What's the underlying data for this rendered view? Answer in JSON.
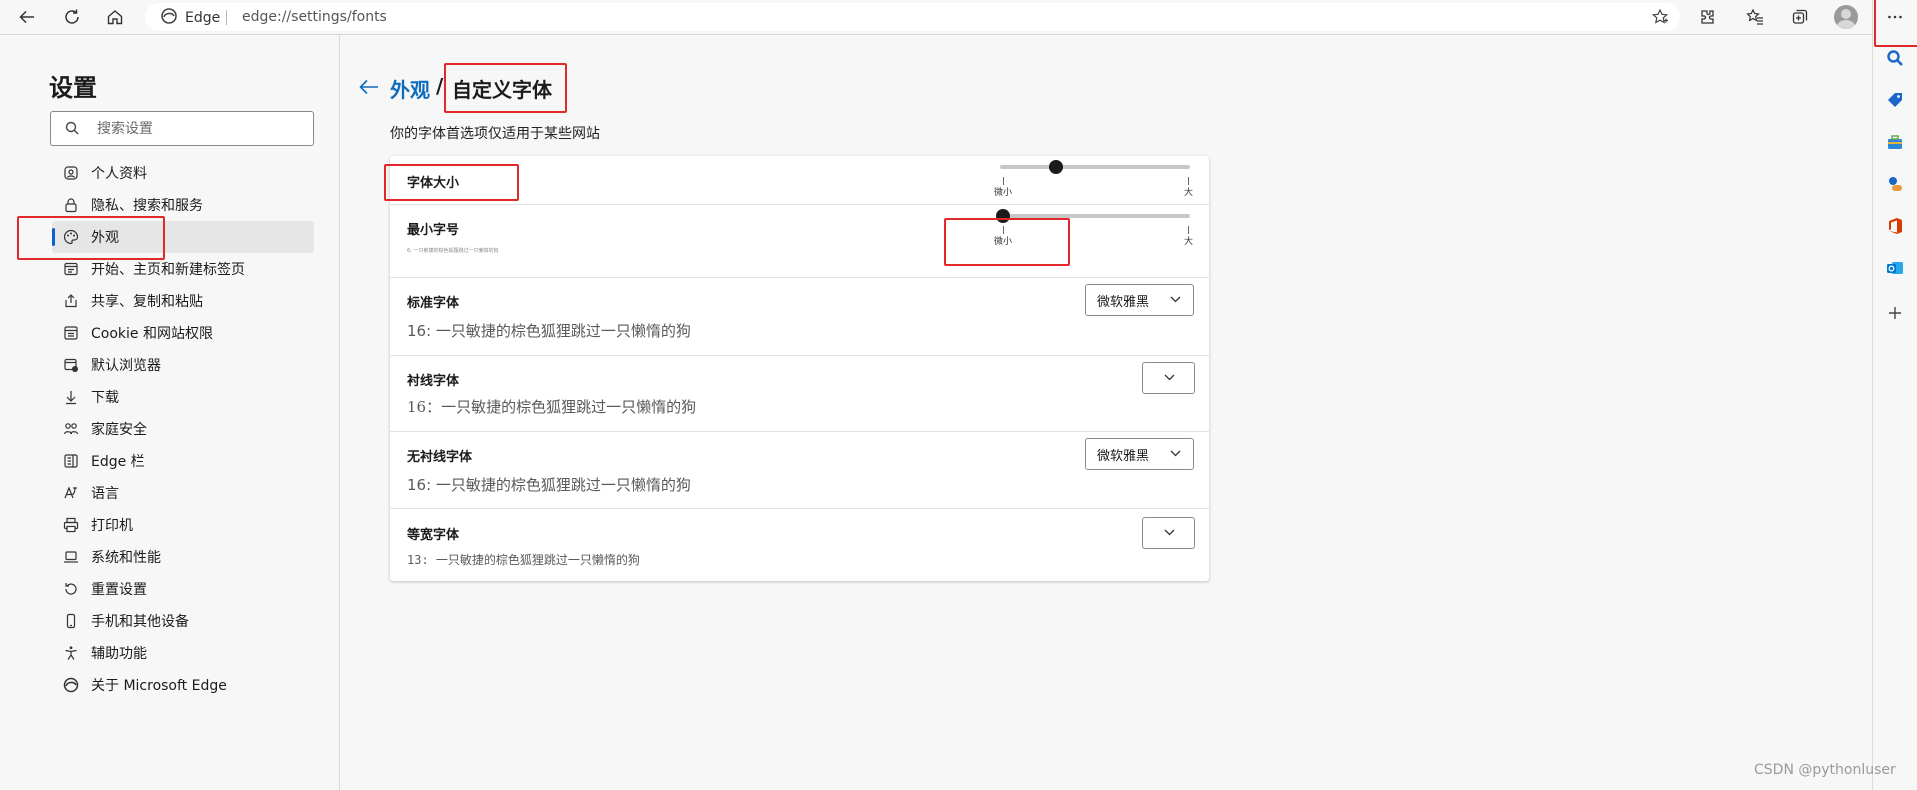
{
  "browser": {
    "address_label": "Edge",
    "address_url": "edge://settings/fonts"
  },
  "sidebar": {
    "title": "设置",
    "search_placeholder": "搜索设置",
    "items": [
      {
        "label": "个人资料",
        "icon": "profile-icon"
      },
      {
        "label": "隐私、搜索和服务",
        "icon": "lock-icon"
      },
      {
        "label": "外观",
        "icon": "appearance-icon",
        "active": true
      },
      {
        "label": "开始、主页和新建标签页",
        "icon": "home-tab-icon"
      },
      {
        "label": "共享、复制和粘贴",
        "icon": "share-icon"
      },
      {
        "label": "Cookie 和网站权限",
        "icon": "cookie-icon"
      },
      {
        "label": "默认浏览器",
        "icon": "default-browser-icon"
      },
      {
        "label": "下载",
        "icon": "download-icon"
      },
      {
        "label": "家庭安全",
        "icon": "family-icon"
      },
      {
        "label": "Edge 栏",
        "icon": "edge-bar-icon"
      },
      {
        "label": "语言",
        "icon": "language-icon"
      },
      {
        "label": "打印机",
        "icon": "printer-icon"
      },
      {
        "label": "系统和性能",
        "icon": "laptop-icon"
      },
      {
        "label": "重置设置",
        "icon": "reset-icon"
      },
      {
        "label": "手机和其他设备",
        "icon": "phone-icon"
      },
      {
        "label": "辅助功能",
        "icon": "accessibility-icon"
      },
      {
        "label": "关于 Microsoft Edge",
        "icon": "edge-logo-icon"
      }
    ]
  },
  "page": {
    "breadcrumb_parent": "外观",
    "breadcrumb_separator": "/",
    "breadcrumb_current": "自定义字体",
    "subtitle": "你的字体首选项仅适用于某些网站",
    "font_size": {
      "label": "字体大小",
      "min_label": "微小",
      "max_label": "大",
      "level": 0.3
    },
    "min_font_size": {
      "label": "最小字号",
      "sample": "6: 一只敏捷的棕色狐狸跳过一只懒惰的狗",
      "min_label": "微小",
      "max_label": "大",
      "level": 0.0
    },
    "standard_font": {
      "label": "标准字体",
      "sample": "16: 一只敏捷的棕色狐狸跳过一只懒惰的狗",
      "selected": "微软雅黑"
    },
    "serif_font": {
      "label": "衬线字体",
      "sample": "16：一只敏捷的棕色狐狸跳过一只懒惰的狗",
      "selected": ""
    },
    "sans_serif_font": {
      "label": "无衬线字体",
      "sample": "16: 一只敏捷的棕色狐狸跳过一只懒惰的狗",
      "selected": "微软雅黑"
    },
    "monospace_font": {
      "label": "等宽字体",
      "sample": "13: 一只敏捷的棕色狐狸跳过一只懒惰的狗",
      "selected": ""
    }
  },
  "watermark": "CSDN @pythonluser",
  "colors": {
    "accent": "#0f6cbd",
    "annotation": "#e2282a"
  }
}
